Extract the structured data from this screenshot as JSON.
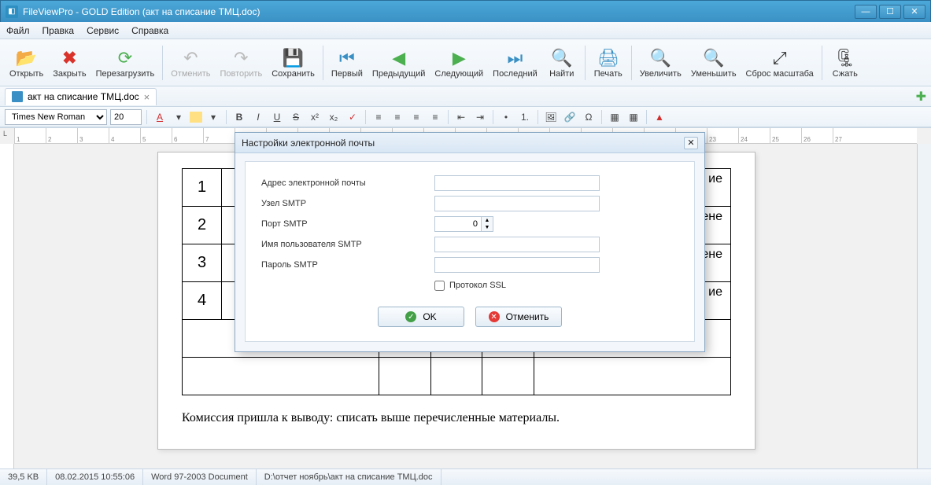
{
  "titlebar": {
    "title": "FileViewPro - GOLD Edition (акт на списание ТМЦ.doc)"
  },
  "menu": {
    "items": [
      "Файл",
      "Правка",
      "Сервис",
      "Справка"
    ]
  },
  "toolbar": {
    "open": "Открыть",
    "close": "Закрыть",
    "reload": "Перезагрузить",
    "undo": "Отменить",
    "redo": "Повторить",
    "save": "Сохранить",
    "first": "Первый",
    "prev": "Предыдущий",
    "next": "Следующий",
    "last": "Последний",
    "find": "Найти",
    "print": "Печать",
    "zoomin": "Увеличить",
    "zoomout": "Уменьшить",
    "zoomreset": "Сброс масштаба",
    "compress": "Сжать"
  },
  "tabs": {
    "doc": "акт на списание ТМЦ.doc"
  },
  "format": {
    "font": "Times New Roman",
    "size": "20"
  },
  "doc": {
    "rows": [
      "1",
      "2",
      "3",
      "4"
    ],
    "trail1": "ие",
    "trail2": "(замене",
    "trail3": "(замене",
    "trail4": "ие",
    "summary": "Комиссия пришла к выводу: списать выше перечисленные материалы."
  },
  "dialog": {
    "title": "Настройки электронной почты",
    "email_lbl": "Адрес электронной почты",
    "smtp_lbl": "Узел SMTP",
    "port_lbl": "Порт SMTP",
    "user_lbl": "Имя пользователя SMTP",
    "pass_lbl": "Пароль SMTP",
    "ssl_lbl": "Протокол SSL",
    "port_val": "0",
    "ok": "OK",
    "cancel": "Отменить"
  },
  "status": {
    "size": "39,5 KB",
    "date": "08.02.2015 10:55:06",
    "type": "Word 97-2003 Document",
    "path": "D:\\отчет  ноябрь\\акт на списание ТМЦ.doc"
  }
}
